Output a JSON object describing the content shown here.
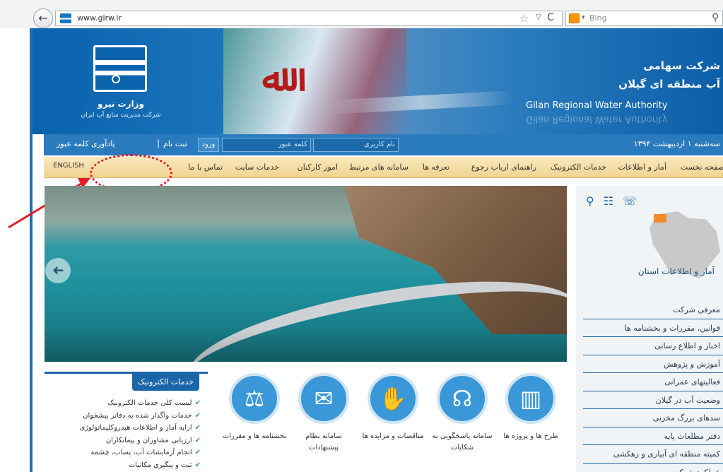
{
  "browser": {
    "url": "www.glrw.ir",
    "search_engine": "Bing",
    "back_glyph": "←",
    "star_glyph": "☆",
    "dropdown_glyph": "▽",
    "reload_glyph": "C",
    "engine_dropdown_glyph": "▾",
    "search_glyph": "⚲"
  },
  "header": {
    "ministry": "وزارت نیرو",
    "ministry_sub": "شرکت مدیریت منابع آب ایران",
    "company_line1": "شرکت سهامی",
    "company_line2": "آب منطقه ای گیلان",
    "company_en": "Gilan Regional Water Authority",
    "emblem_glyph": "ﷲ"
  },
  "login": {
    "date": "سه‌شنبه ۱ اردیبهشت ۱۳۹۴",
    "username_placeholder": "نام کاربری",
    "password_placeholder": "کلمه عبور",
    "login_label": "ورود",
    "register_label": "ثبت نام",
    "separator": "|",
    "forgot_label": "یادآوری کلمه عبور"
  },
  "nav": {
    "items": [
      "صفحه نخست",
      "آمار و اطلاعات",
      "خدمات الکترونیک",
      "راهنمای ارباب رجوع",
      "تعرفه ها",
      "سامانه های مرتبط",
      "امور کارکنان",
      "خدمات سایت",
      "تماس با ما"
    ],
    "english": "ENGLISH"
  },
  "slider": {
    "prev_glyph": "➜"
  },
  "sidebar": {
    "icons": "⚲ ☷ ☏",
    "stats_title": "آمار و اطلاعات استان",
    "links": [
      "معرفی شرکت",
      "قوانین، مقررات و بخشنامه ها",
      "اخبار و اطلاع رسانی",
      "آموزش و پژوهش",
      "فعالیتهای عمرانی",
      "وضعیت آب در گیلان",
      "سدهای بزرگ مخزنی",
      "دفتر مطلعات پایه",
      "کمیته منطقه ای آبیاری و زهکشی",
      "عملکرد شرکت"
    ]
  },
  "eservices": {
    "title": "خدمات الکترونیک",
    "check_glyph": "✔",
    "items": [
      "لیست کلی خدمات الکترونیک",
      "خدمات واگذار شده به دفاتر پیشخوان",
      "ارایه آمار و اطلاعات هیدروکلیماتولوژی",
      "ارزیابی مشاوران و پیمانکاران",
      "انجام آزمایشات آب، پساب، چشمه",
      "ثبت و پیگیری مکاتبات"
    ]
  },
  "services": [
    {
      "glyph": "▥",
      "label": "طرح ها و پروژه ها"
    },
    {
      "glyph": "☊",
      "label": "سامانه پاسخگویی به شکایات"
    },
    {
      "glyph": "✋",
      "label": "مناقصات و مزایده ها"
    },
    {
      "glyph": "✉",
      "label": "سامانه نظام پیشنهادات"
    },
    {
      "glyph": "⚖",
      "label": "بخشنامه ها و مقررات"
    }
  ]
}
